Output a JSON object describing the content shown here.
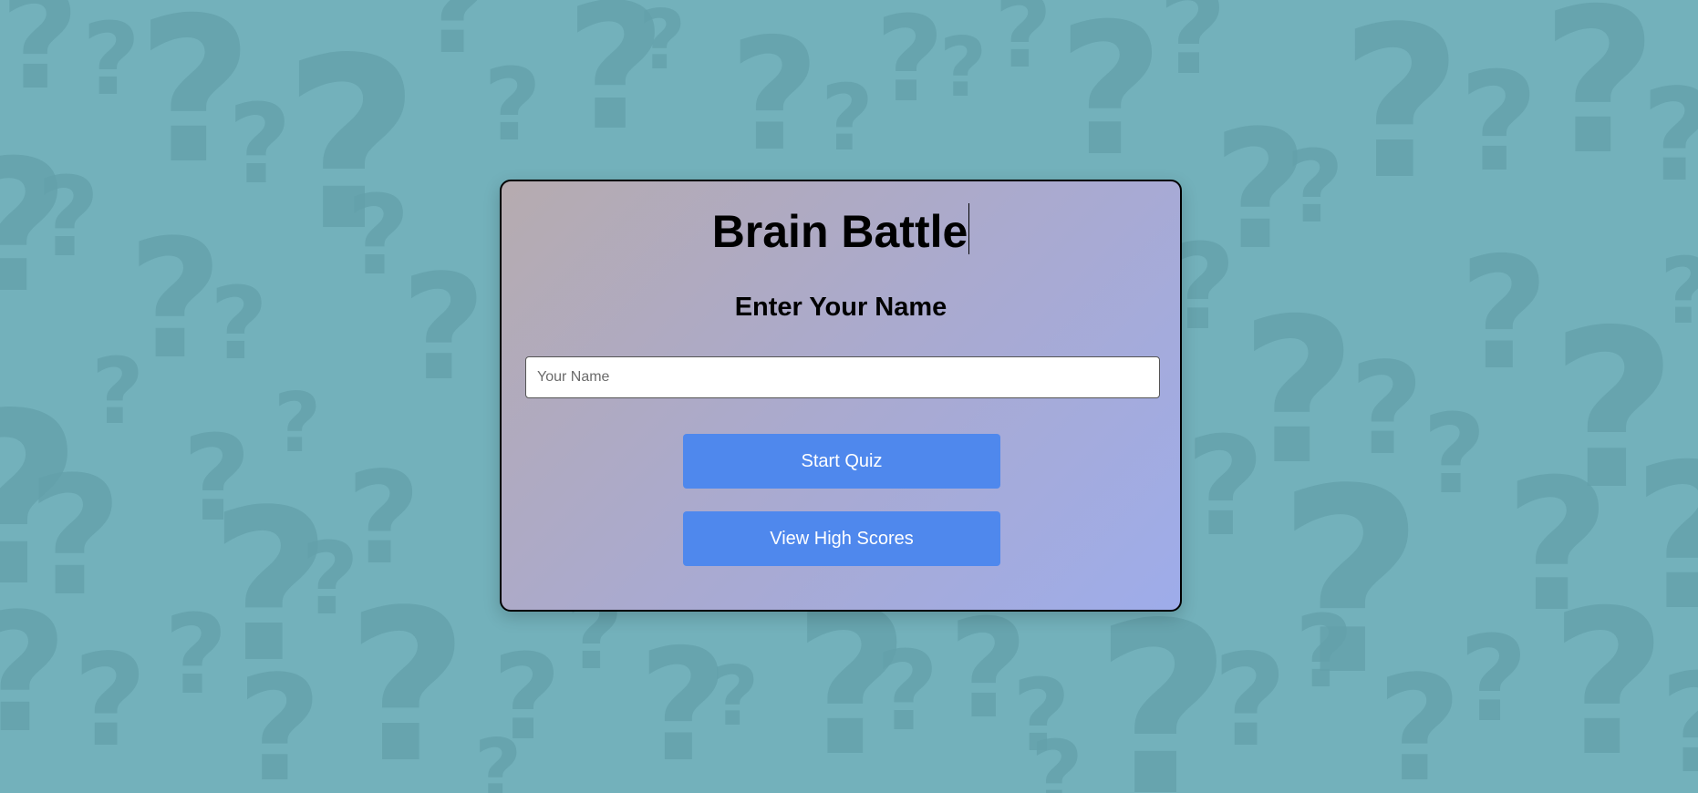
{
  "app": {
    "title": "Brain Battle",
    "subtitle": "Enter Your Name"
  },
  "form": {
    "name_value": "",
    "name_placeholder": "Your Name"
  },
  "buttons": {
    "start_label": "Start Quiz",
    "scores_label": "View High Scores"
  },
  "colors": {
    "background": "#73b1bb",
    "pattern": "#63a0aa",
    "button": "#4f88ed",
    "card_gradient_start": "#b6abaf",
    "card_gradient_end": "#9eacea"
  },
  "background_pattern": {
    "glyph": "?",
    "icon": "question-mark-icon"
  }
}
